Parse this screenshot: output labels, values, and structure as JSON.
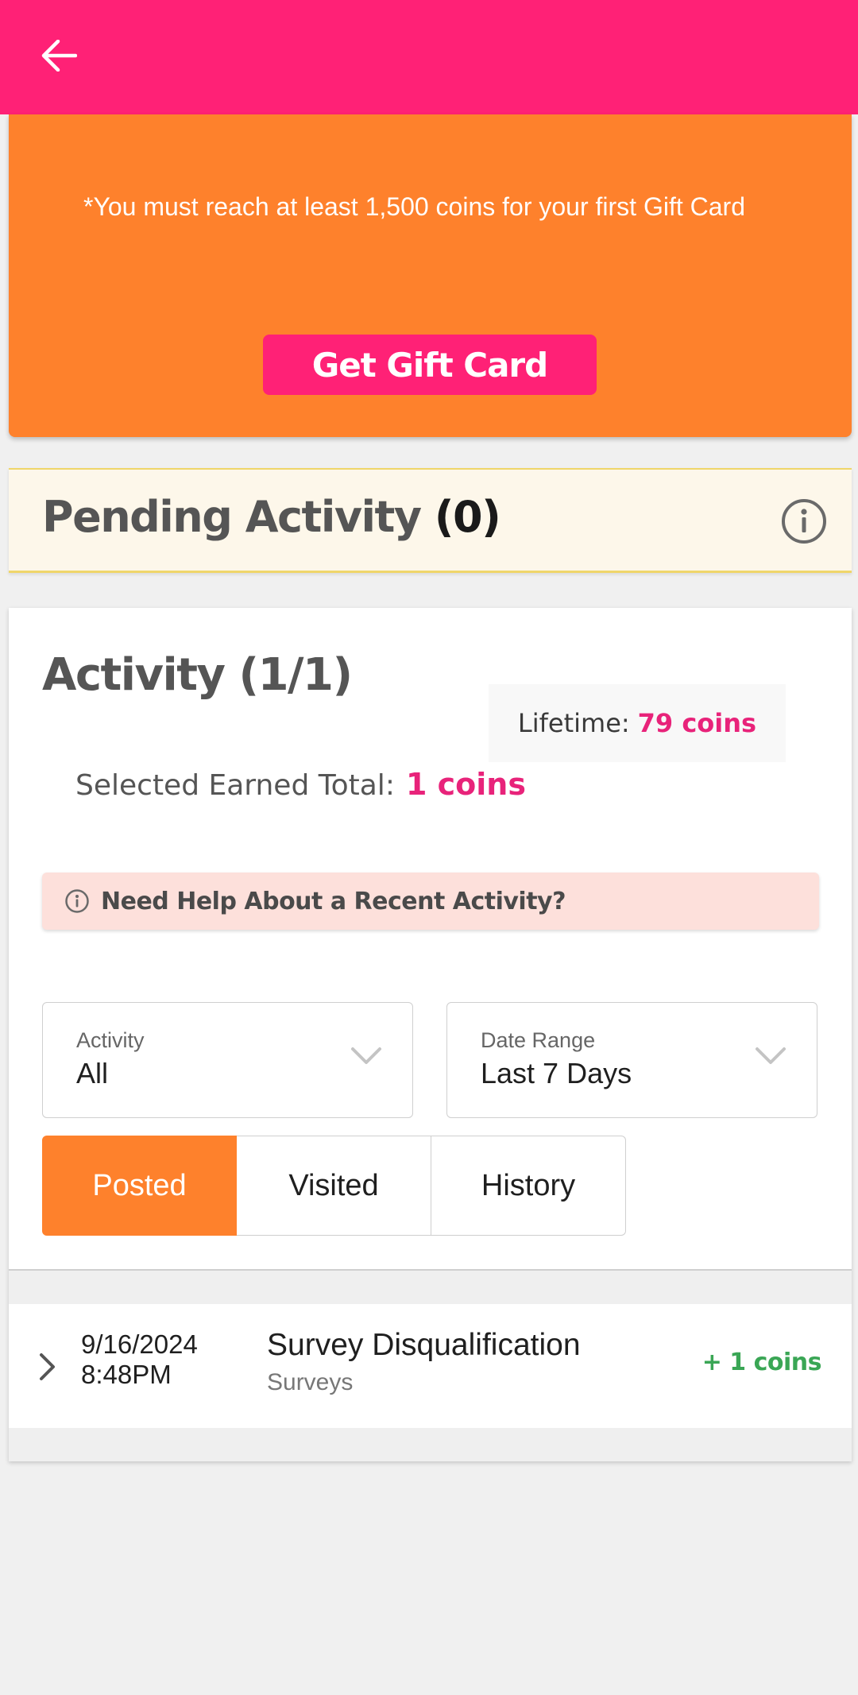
{
  "header": {
    "back_icon": "arrow-left-icon",
    "background": "#ff2176"
  },
  "gift_card": {
    "note": "*You must reach at least 1,500 coins for your first Gift Card",
    "button_label": "Get Gift Card",
    "background": "#fe812c"
  },
  "pending": {
    "title": "Pending Activity",
    "count": "(0)",
    "info_icon": "info-circle-icon"
  },
  "activity": {
    "title": "Activity (1/1)",
    "lifetime_label": "Lifetime:",
    "lifetime_value": "79 coins",
    "selected_label": "Selected Earned Total:",
    "selected_value": "1 coins",
    "help_text": "Need Help About a Recent Activity?",
    "filters": {
      "activity_label": "Activity",
      "activity_value": "All",
      "date_label": "Date Range",
      "date_value": "Last 7 Days"
    },
    "tabs": [
      {
        "label": "Posted",
        "active": true
      },
      {
        "label": "Visited",
        "active": false
      },
      {
        "label": "History",
        "active": false
      }
    ],
    "rows": [
      {
        "date": "9/16/2024",
        "time": "8:48PM",
        "title": "Survey Disqualification",
        "category": "Surveys",
        "coins": "+ 1 coins"
      }
    ]
  },
  "colors": {
    "accent_pink": "#e8237a",
    "accent_orange": "#fe812c",
    "positive_green": "#3aa655"
  }
}
